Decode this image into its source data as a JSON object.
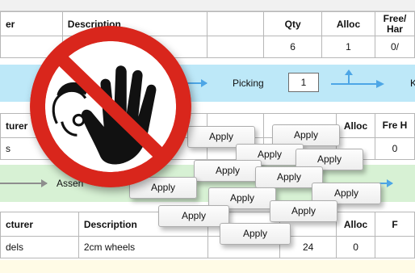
{
  "table1": {
    "headers": [
      "er",
      "Description",
      "",
      "Qty",
      "Alloc",
      "Free/ Har"
    ],
    "row": [
      "",
      "",
      "",
      "6",
      "1",
      "0/"
    ]
  },
  "band1": {
    "step_label": "Picking",
    "step_value": "1",
    "right_label": "K"
  },
  "table2": {
    "headers": [
      "turer",
      "",
      "",
      "",
      "Alloc",
      "Fre H"
    ],
    "row": [
      "s",
      "",
      "",
      "",
      "",
      "0"
    ]
  },
  "band2": {
    "step_label": "Assen"
  },
  "table3": {
    "headers": [
      "cturer",
      "Description",
      "",
      "",
      "Alloc",
      "F"
    ],
    "row": [
      "dels",
      "2cm wheels",
      "",
      "24",
      "0",
      ""
    ]
  },
  "apply_buttons": [
    "Apply",
    "Apply",
    "Apply",
    "Apply",
    "Apply",
    "Apply",
    "Apply",
    "Apply",
    "Apply",
    "Apply",
    "Apply",
    "Apply",
    "Apply",
    "Apply"
  ],
  "colors": {
    "band_blue": "#bde8f8",
    "band_green": "#d7f1d4",
    "arrow_blue": "#4da6e6",
    "sign_red": "#d9261c"
  },
  "overlay_icon": "prohibited-stop-hand-icon"
}
